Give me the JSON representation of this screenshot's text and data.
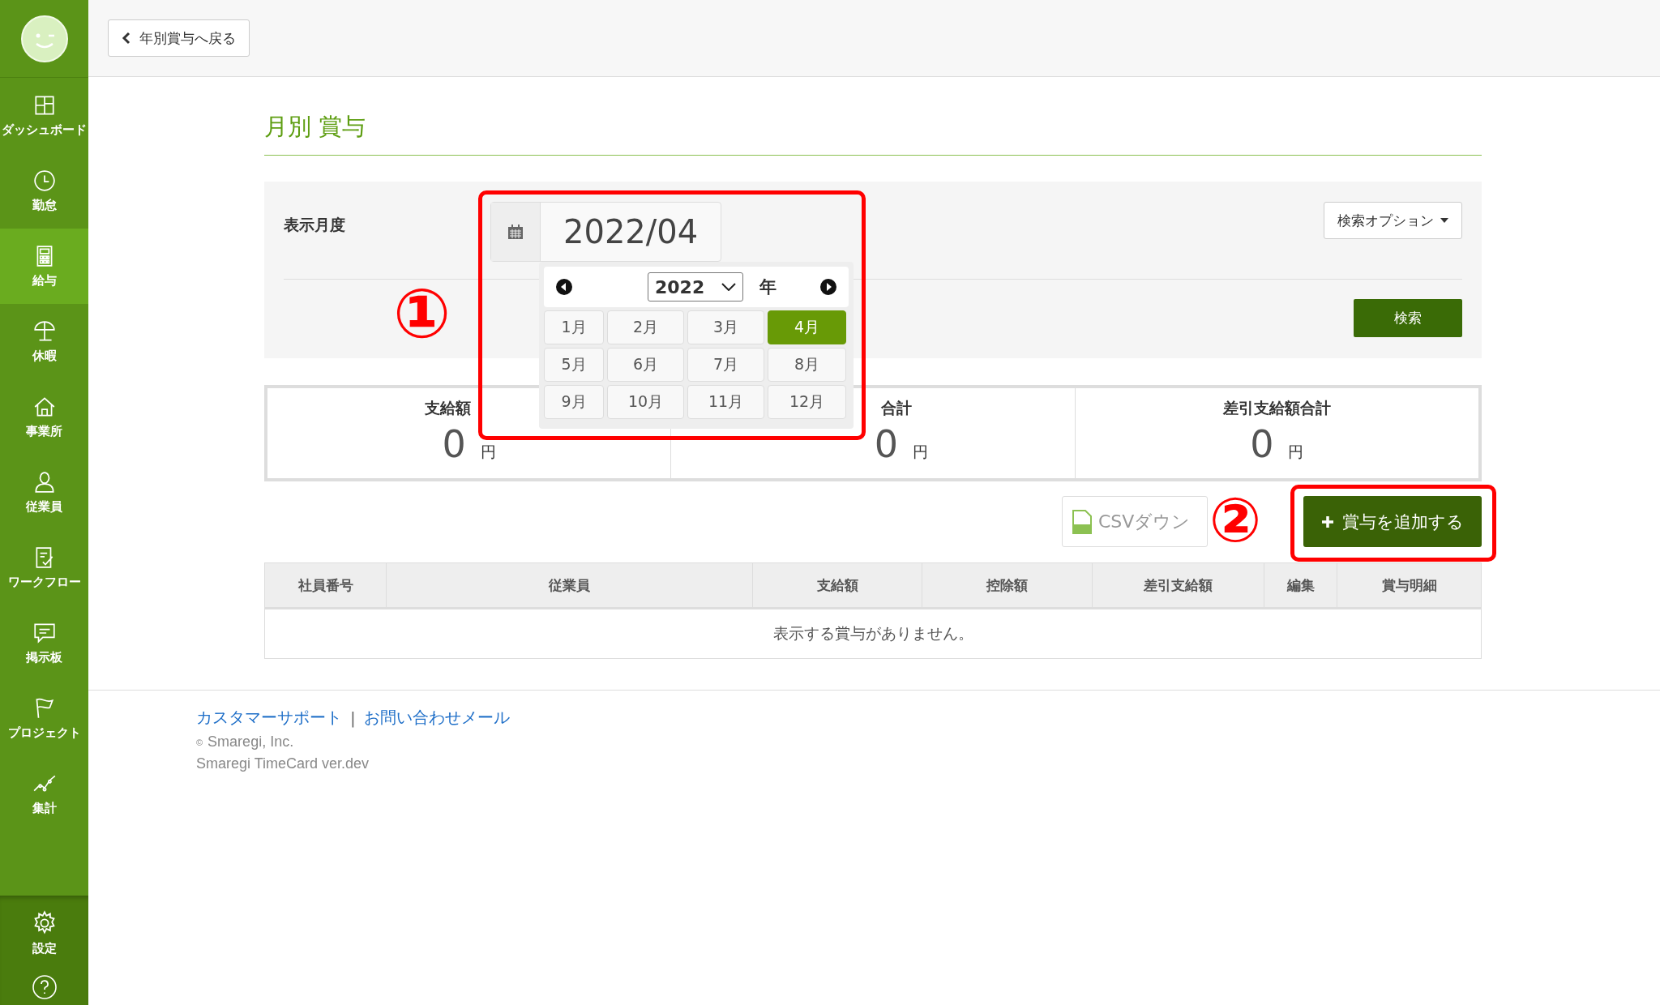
{
  "sidebar": {
    "items": [
      {
        "label": "ダッシュボード",
        "selected": false
      },
      {
        "label": "勤怠",
        "selected": false
      },
      {
        "label": "給与",
        "selected": true
      },
      {
        "label": "休暇",
        "selected": false
      },
      {
        "label": "事業所",
        "selected": false
      },
      {
        "label": "従業員",
        "selected": false
      },
      {
        "label": "ワークフロー",
        "selected": false
      },
      {
        "label": "掲示板",
        "selected": false
      },
      {
        "label": "プロジェクト",
        "selected": false
      },
      {
        "label": "集計",
        "selected": false
      }
    ],
    "bottom_items": [
      {
        "label": "設定"
      }
    ]
  },
  "top_bar": {
    "back_button": "年別賞与へ戻る"
  },
  "page_title": "月別 賞与",
  "filter": {
    "label": "表示月度",
    "date_value": "2022/04",
    "options_button": "検索オプション",
    "search_button": "検索"
  },
  "month_picker": {
    "year": "2022",
    "year_suffix": "年",
    "months": [
      {
        "label": "1月",
        "selected": false
      },
      {
        "label": "2月",
        "selected": false
      },
      {
        "label": "3月",
        "selected": false
      },
      {
        "label": "4月",
        "selected": true
      },
      {
        "label": "5月",
        "selected": false
      },
      {
        "label": "6月",
        "selected": false
      },
      {
        "label": "7月",
        "selected": false
      },
      {
        "label": "8月",
        "selected": false
      },
      {
        "label": "9月",
        "selected": false
      },
      {
        "label": "10月",
        "selected": false
      },
      {
        "label": "11月",
        "selected": false
      },
      {
        "label": "12月",
        "selected": false
      }
    ]
  },
  "summary": [
    {
      "label": "支給額",
      "value": "0",
      "unit": "円"
    },
    {
      "label": "合計",
      "value": "0",
      "unit": "円"
    },
    {
      "label": "差引支給額合計",
      "value": "0",
      "unit": "円"
    }
  ],
  "actions": {
    "csv_button": "CSVダウン",
    "add_button": "賞与を追加する"
  },
  "table": {
    "columns": [
      "社員番号",
      "従業員",
      "支給額",
      "控除額",
      "差引支給額",
      "編集",
      "賞与明細"
    ],
    "empty_message": "表示する賞与がありません。"
  },
  "annotations": [
    "①",
    "②"
  ],
  "footer": {
    "links": [
      "カスタマーサポート",
      "お問い合わせメール"
    ],
    "separator": "|",
    "copyright": "Smaregi, Inc.",
    "copyright_mark": "©",
    "version": "Smaregi TimeCard ver.dev"
  }
}
